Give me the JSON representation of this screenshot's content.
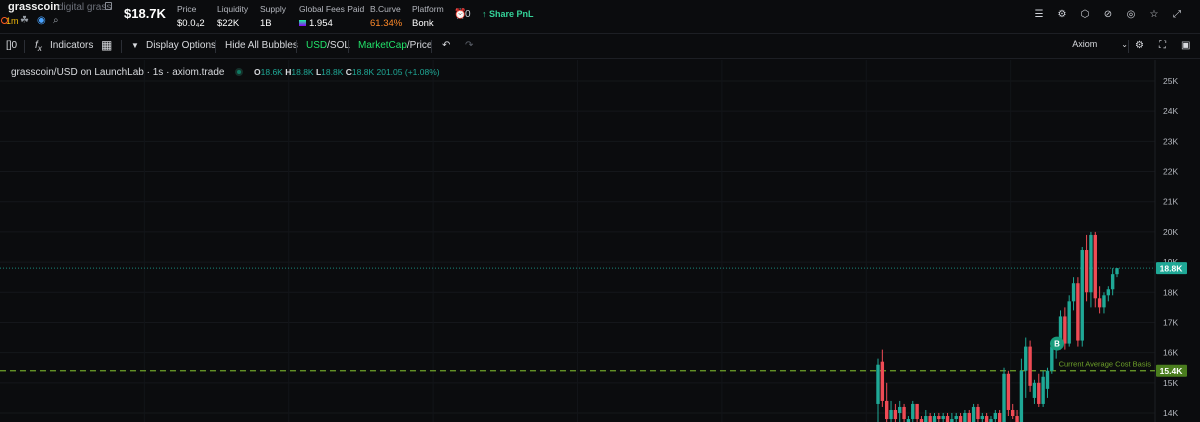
{
  "header": {
    "token_name": "grasscoin",
    "token_desc": "digital grass",
    "age": "1m",
    "market_cap": "$18.7K",
    "stats": [
      {
        "label": "Price",
        "value": "$0.0₄2"
      },
      {
        "label": "Liquidity",
        "value": "$22K"
      },
      {
        "label": "Supply",
        "value": "1B"
      },
      {
        "label": "Global Fees Paid",
        "value": "1.954"
      },
      {
        "label": "B.Curve",
        "value": "61.34%"
      },
      {
        "label": "Platform",
        "value": "Bonk"
      }
    ],
    "alarm_count": "0",
    "share_pnl": "Share PnL"
  },
  "toolbar": {
    "interval": "[]0",
    "indicators": "Indicators",
    "display_options": "Display Options",
    "hide_bubbles": "Hide All Bubbles",
    "usd": "USD",
    "sol": "/SOL",
    "marketcap": "MarketCap",
    "price": "/Price",
    "source_select": "Axiom"
  },
  "chart": {
    "legend_title": "grasscoin/USD on LaunchLab · 1s · axiom.trade",
    "ohlc": {
      "o": "18.6K",
      "h": "18.8K",
      "l": "18.8K",
      "c": "18.8K",
      "change": "201.05 (+1.08%)"
    },
    "current_label": "18.8K",
    "cost_basis_label": "15.4K",
    "cost_basis_text": "Current Average Cost Basis",
    "buy_bubble": "B",
    "axis_ticks": [
      "25K",
      "24K",
      "23K",
      "22K",
      "21K",
      "20K",
      "19K",
      "18K",
      "17K",
      "16K",
      "15K",
      "14K"
    ],
    "colors": {
      "up": "#1fa896",
      "down": "#ef4b55",
      "basis": "#6fa32a",
      "current": "#1fa896"
    }
  },
  "chart_data": {
    "type": "candlestick",
    "y_unit": "market cap USD",
    "ylim": [
      13800,
      25400
    ],
    "current_value": 18800,
    "cost_basis": 15400,
    "candles": [
      {
        "o": 14300,
        "h": 15800,
        "l": 13600,
        "c": 15600
      },
      {
        "o": 15700,
        "h": 16100,
        "l": 14200,
        "c": 14400
      },
      {
        "o": 14400,
        "h": 15000,
        "l": 13600,
        "c": 13800
      },
      {
        "o": 13800,
        "h": 14400,
        "l": 13700,
        "c": 14100
      },
      {
        "o": 14100,
        "h": 14300,
        "l": 13700,
        "c": 13800
      },
      {
        "o": 14000,
        "h": 14400,
        "l": 13600,
        "c": 14200
      },
      {
        "o": 14200,
        "h": 14300,
        "l": 13600,
        "c": 13800
      },
      {
        "o": 13700,
        "h": 13900,
        "l": 13600,
        "c": 13800
      },
      {
        "o": 13800,
        "h": 14400,
        "l": 13600,
        "c": 14300
      },
      {
        "o": 14300,
        "h": 14300,
        "l": 13700,
        "c": 13800
      },
      {
        "o": 13800,
        "h": 13900,
        "l": 13600,
        "c": 13700
      },
      {
        "o": 13700,
        "h": 14100,
        "l": 13600,
        "c": 13900
      },
      {
        "o": 13900,
        "h": 14000,
        "l": 13600,
        "c": 13700
      },
      {
        "o": 13700,
        "h": 14000,
        "l": 13600,
        "c": 13900
      },
      {
        "o": 13900,
        "h": 14000,
        "l": 13600,
        "c": 13800
      },
      {
        "o": 13800,
        "h": 14000,
        "l": 13600,
        "c": 13900
      },
      {
        "o": 13900,
        "h": 14000,
        "l": 13600,
        "c": 13700
      },
      {
        "o": 13700,
        "h": 14000,
        "l": 13600,
        "c": 13800
      },
      {
        "o": 13800,
        "h": 14000,
        "l": 13600,
        "c": 13900
      },
      {
        "o": 13900,
        "h": 14000,
        "l": 13600,
        "c": 13700
      },
      {
        "o": 13700,
        "h": 14100,
        "l": 13600,
        "c": 14000
      },
      {
        "o": 14000,
        "h": 14100,
        "l": 13600,
        "c": 13700
      },
      {
        "o": 13700,
        "h": 14300,
        "l": 13600,
        "c": 14200
      },
      {
        "o": 14200,
        "h": 14300,
        "l": 13600,
        "c": 13800
      },
      {
        "o": 13800,
        "h": 14000,
        "l": 13600,
        "c": 13900
      },
      {
        "o": 13900,
        "h": 14000,
        "l": 13600,
        "c": 13700
      },
      {
        "o": 13700,
        "h": 13900,
        "l": 13600,
        "c": 13800
      },
      {
        "o": 13800,
        "h": 14100,
        "l": 13600,
        "c": 14000
      },
      {
        "o": 14000,
        "h": 14100,
        "l": 13600,
        "c": 13700
      },
      {
        "o": 13700,
        "h": 15500,
        "l": 13600,
        "c": 15300
      },
      {
        "o": 15300,
        "h": 15400,
        "l": 13900,
        "c": 14100
      },
      {
        "o": 14100,
        "h": 14300,
        "l": 13800,
        "c": 13900
      },
      {
        "o": 13900,
        "h": 14100,
        "l": 13600,
        "c": 13700
      },
      {
        "o": 13700,
        "h": 15800,
        "l": 13600,
        "c": 15400
      },
      {
        "o": 15400,
        "h": 16500,
        "l": 14500,
        "c": 16200
      },
      {
        "o": 16200,
        "h": 16400,
        "l": 14700,
        "c": 14900
      },
      {
        "o": 14500,
        "h": 15100,
        "l": 14300,
        "c": 15000
      },
      {
        "o": 15000,
        "h": 15300,
        "l": 14200,
        "c": 14300
      },
      {
        "o": 14300,
        "h": 15400,
        "l": 14200,
        "c": 15200
      },
      {
        "o": 14800,
        "h": 15500,
        "l": 14500,
        "c": 15400
      },
      {
        "o": 15400,
        "h": 16400,
        "l": 15300,
        "c": 16200
      },
      {
        "o": 16200,
        "h": 16400,
        "l": 15800,
        "c": 16300
      },
      {
        "o": 16300,
        "h": 17400,
        "l": 16100,
        "c": 17200
      },
      {
        "o": 17200,
        "h": 17500,
        "l": 16100,
        "c": 16300
      },
      {
        "o": 16300,
        "h": 17900,
        "l": 16200,
        "c": 17700
      },
      {
        "o": 17700,
        "h": 18500,
        "l": 17400,
        "c": 18300
      },
      {
        "o": 18300,
        "h": 18500,
        "l": 16200,
        "c": 16400
      },
      {
        "o": 16400,
        "h": 19500,
        "l": 16200,
        "c": 19400
      },
      {
        "o": 19400,
        "h": 19900,
        "l": 17700,
        "c": 18000
      },
      {
        "o": 18000,
        "h": 20000,
        "l": 17500,
        "c": 19900
      },
      {
        "o": 19900,
        "h": 20000,
        "l": 17500,
        "c": 17800
      },
      {
        "o": 17800,
        "h": 18200,
        "l": 17300,
        "c": 17500
      },
      {
        "o": 17500,
        "h": 18000,
        "l": 17300,
        "c": 17900
      },
      {
        "o": 17900,
        "h": 18200,
        "l": 17700,
        "c": 18100
      },
      {
        "o": 18100,
        "h": 18800,
        "l": 17900,
        "c": 18600
      },
      {
        "o": 18600,
        "h": 18800,
        "l": 18500,
        "c": 18800
      }
    ]
  }
}
